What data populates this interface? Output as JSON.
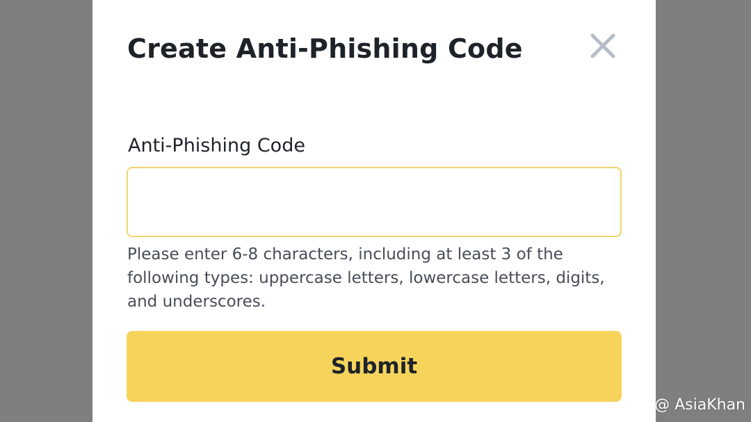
{
  "modal": {
    "title": "Create Anti-Phishing Code",
    "close_icon": "close-icon",
    "field": {
      "label": "Anti-Phishing Code",
      "value": "",
      "placeholder": ""
    },
    "helper_text": "Please enter 6-8 characters, including at least 3 of the following types: uppercase letters, lowercase letters, digits, and underscores.",
    "submit_label": "Submit"
  },
  "watermark": {
    "icon": "binance-logo-icon",
    "handle": "@ AsiaKhan"
  },
  "colors": {
    "overlay": "#7f7f7f",
    "accent": "#f6d45c",
    "input_border_focus": "#f0d46c",
    "text_primary": "#1e2329",
    "text_secondary": "#474d57"
  }
}
